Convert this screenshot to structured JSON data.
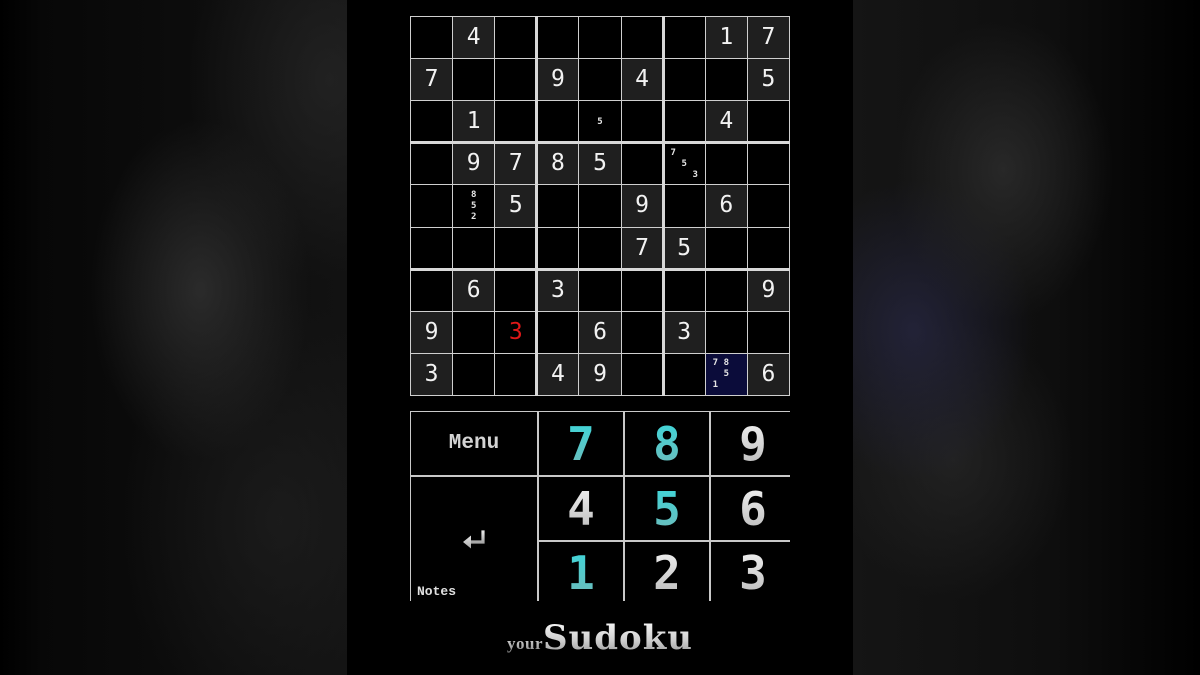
{
  "board": {
    "rows": [
      [
        null,
        4,
        null,
        null,
        null,
        null,
        null,
        1,
        7
      ],
      [
        7,
        null,
        null,
        9,
        null,
        4,
        null,
        null,
        5
      ],
      [
        null,
        1,
        null,
        null,
        null,
        null,
        null,
        4,
        null
      ],
      [
        null,
        9,
        7,
        8,
        5,
        null,
        null,
        null,
        null
      ],
      [
        null,
        null,
        5,
        null,
        null,
        9,
        null,
        6,
        null
      ],
      [
        null,
        null,
        null,
        null,
        null,
        7,
        5,
        null,
        null
      ],
      [
        null,
        6,
        null,
        3,
        null,
        null,
        null,
        null,
        9
      ],
      [
        9,
        null,
        null,
        null,
        6,
        null,
        3,
        null,
        null
      ],
      [
        3,
        null,
        null,
        4,
        9,
        null,
        null,
        null,
        6
      ]
    ],
    "user_entries": [
      {
        "row": 7,
        "col": 2,
        "value": 3,
        "status": "error"
      }
    ],
    "notes": [
      {
        "row": 2,
        "col": 4,
        "values": [
          5
        ]
      },
      {
        "row": 3,
        "col": 6,
        "values": [
          7,
          5,
          3
        ]
      },
      {
        "row": 4,
        "col": 1,
        "values": [
          8,
          5,
          2
        ]
      },
      {
        "row": 8,
        "col": 7,
        "values": [
          7,
          8,
          5,
          1
        ]
      }
    ],
    "selected": {
      "row": 8,
      "col": 7
    },
    "colors": {
      "given_bg": "#1f1f1f",
      "empty_bg": "#000000",
      "selected_bg": "#0b0c3a",
      "error_text": "#e01818",
      "digit_text": "#f2f2f2",
      "grid_lines": "#cfcfcf"
    }
  },
  "keypad": {
    "menu_label": "Menu",
    "notes_label": "Notes",
    "enter_icon": "return-arrow-icon",
    "digits": [
      {
        "value": "7",
        "active": true
      },
      {
        "value": "8",
        "active": true
      },
      {
        "value": "9",
        "active": false
      },
      {
        "value": "4",
        "active": false
      },
      {
        "value": "5",
        "active": true
      },
      {
        "value": "6",
        "active": false
      },
      {
        "value": "1",
        "active": true
      },
      {
        "value": "2",
        "active": false
      },
      {
        "value": "3",
        "active": false
      }
    ],
    "colors": {
      "active_digit": "#3fd6d9",
      "inactive_digit": "#d0d0d0"
    }
  },
  "logo": {
    "prefix": "your",
    "name": "Sudoku"
  }
}
